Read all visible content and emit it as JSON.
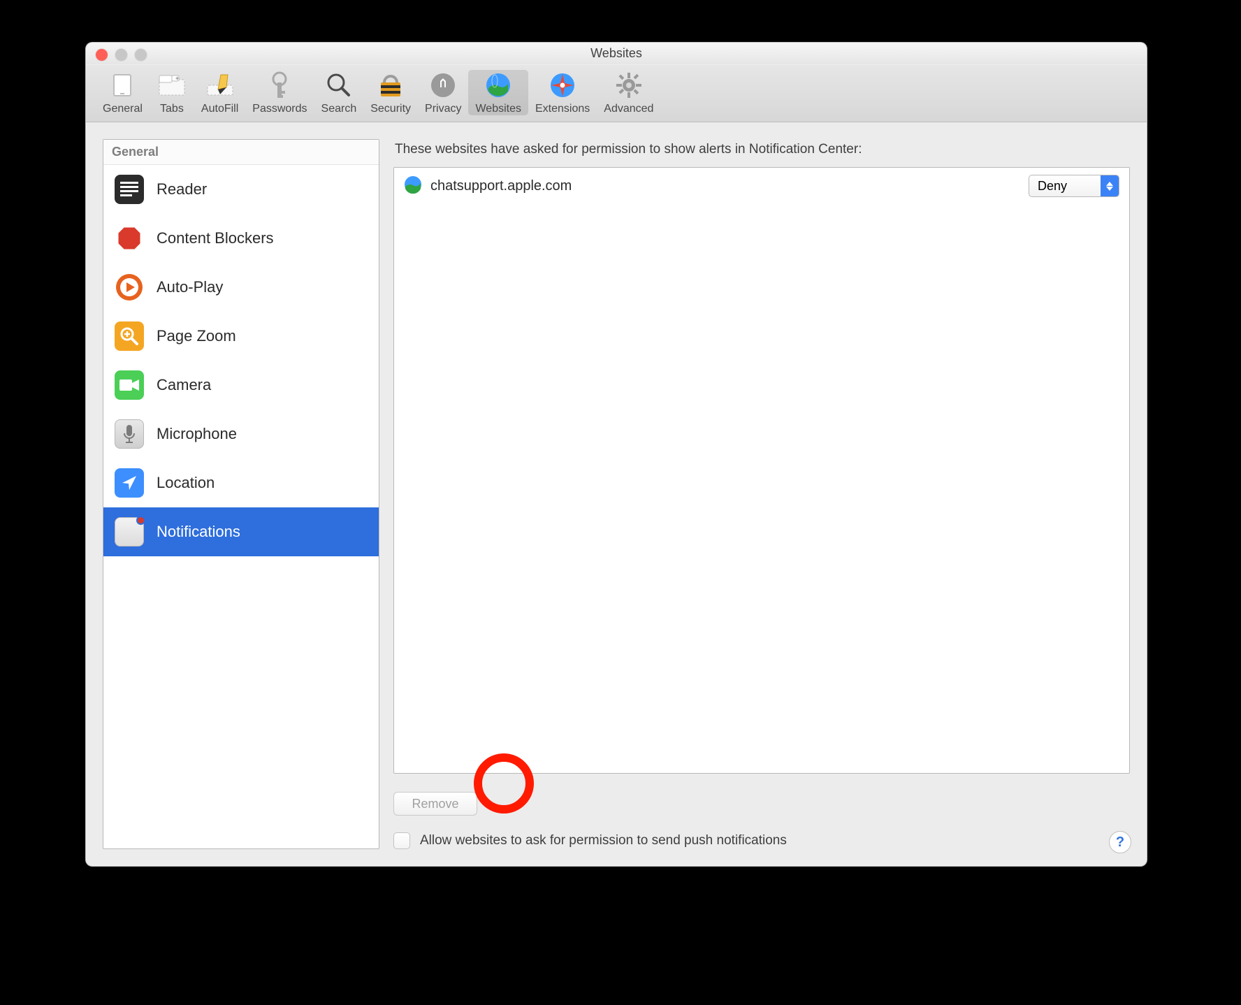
{
  "window": {
    "title": "Websites"
  },
  "toolbar": {
    "items": [
      {
        "label": "General"
      },
      {
        "label": "Tabs"
      },
      {
        "label": "AutoFill"
      },
      {
        "label": "Passwords"
      },
      {
        "label": "Search"
      },
      {
        "label": "Security"
      },
      {
        "label": "Privacy"
      },
      {
        "label": "Websites"
      },
      {
        "label": "Extensions"
      },
      {
        "label": "Advanced"
      }
    ]
  },
  "sidebar": {
    "header": "General",
    "items": [
      {
        "label": "Reader"
      },
      {
        "label": "Content Blockers"
      },
      {
        "label": "Auto-Play"
      },
      {
        "label": "Page Zoom"
      },
      {
        "label": "Camera"
      },
      {
        "label": "Microphone"
      },
      {
        "label": "Location"
      },
      {
        "label": "Notifications"
      }
    ]
  },
  "main": {
    "caption": "These websites have asked for permission to show alerts in Notification Center:",
    "sites": [
      {
        "domain": "chatsupport.apple.com",
        "permission": "Deny"
      }
    ],
    "remove_label": "Remove",
    "allow_label": "Allow websites to ask for permission to send push notifications",
    "allow_checked": false
  },
  "help": "?"
}
